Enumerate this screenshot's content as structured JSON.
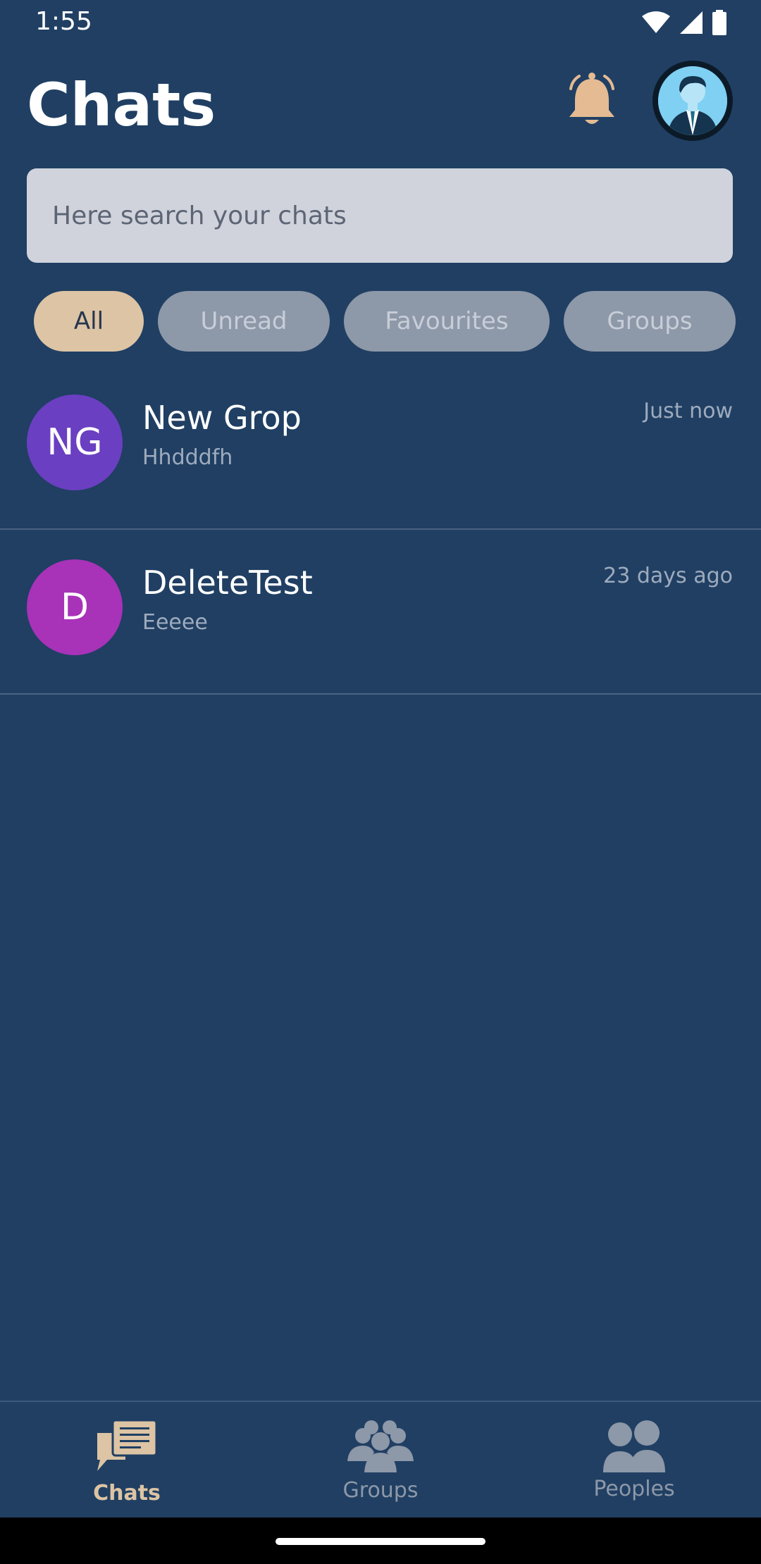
{
  "status_bar": {
    "time": "1:55"
  },
  "header": {
    "title": "Chats"
  },
  "search": {
    "placeholder": "Here search your chats",
    "value": ""
  },
  "filters": [
    {
      "label": "All",
      "active": true
    },
    {
      "label": "Unread",
      "active": false
    },
    {
      "label": "Favourites",
      "active": false
    },
    {
      "label": "Groups",
      "active": false
    }
  ],
  "chats": [
    {
      "initials": "NG",
      "name": "New Grop",
      "last_message": "Hhdddfh",
      "time": "Just now",
      "avatar_color": "#6a3fc1"
    },
    {
      "initials": "D",
      "name": "DeleteTest",
      "last_message": "Eeeee",
      "time": "23 days ago",
      "avatar_color": "#a832b8"
    }
  ],
  "bottom_nav": [
    {
      "label": "Chats",
      "icon": "chat-icon",
      "active": true
    },
    {
      "label": "Groups",
      "icon": "groups-icon",
      "active": false
    },
    {
      "label": "Peoples",
      "icon": "people-icon",
      "active": false
    }
  ],
  "colors": {
    "background": "#203f63",
    "accent": "#dcc4a4",
    "inactive": "#8d98a8"
  }
}
